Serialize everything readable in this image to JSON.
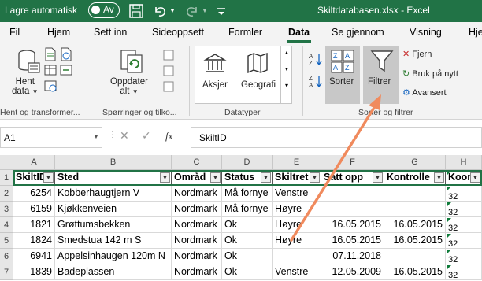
{
  "titlebar": {
    "autosave_label": "Lagre automatisk",
    "toggle_state": "Av",
    "filename": "Skiltdatabasen.xlsx",
    "app": "Excel"
  },
  "tabs": [
    "Fil",
    "Hjem",
    "Sett inn",
    "Sideoppsett",
    "Formler",
    "Data",
    "Se gjennom",
    "Visning",
    "Hje"
  ],
  "active_tab": "Data",
  "ribbon": {
    "get_data": {
      "line1": "Hent",
      "line2": "data"
    },
    "group1_label": "Hent og transformer...",
    "refresh": {
      "line1": "Oppdater",
      "line2": "alt"
    },
    "group2_label": "Spørringer og tilko...",
    "stocks": "Aksjer",
    "geography": "Geografi",
    "group3_label": "Datatyper",
    "sort": "Sorter",
    "filter": "Filtrer",
    "clear": "Fjern",
    "reapply": "Bruk på nytt",
    "advanced": "Avansert",
    "group4_label": "Sorter og filtrer"
  },
  "formula_bar": {
    "name_box": "A1",
    "fx": "fx",
    "formula": "SkiltID"
  },
  "grid": {
    "columns": [
      "A",
      "B",
      "C",
      "D",
      "E",
      "F",
      "G",
      "H"
    ],
    "rows": [
      "1",
      "2",
      "3",
      "4",
      "5",
      "6",
      "7"
    ],
    "header": [
      "SkiltID",
      "Sted",
      "Områd",
      "Status",
      "Skiltret",
      "Satt opp",
      "Kontrolle",
      "Koordi"
    ],
    "data": [
      [
        "6254",
        "Kobberhaugtjern V",
        "Nordmark",
        "Må fornye",
        "Venstre",
        "",
        "",
        ""
      ],
      [
        "6159",
        "Kjøkkenveien",
        "Nordmark",
        "Må fornye",
        "Høyre",
        "",
        "",
        ""
      ],
      [
        "1821",
        "Grøttumsbekken",
        "Nordmark",
        "Ok",
        "Høyre",
        "16.05.2015",
        "16.05.2015",
        ""
      ],
      [
        "1824",
        "Smedstua 142 m S",
        "Nordmark",
        "Ok",
        "Høyre",
        "16.05.2015",
        "16.05.2015",
        ""
      ],
      [
        "6941",
        "Appelsinhaugen 120m N",
        "Nordmark",
        "Ok",
        "",
        "07.11.2018",
        "",
        ""
      ],
      [
        "1839",
        "Badeplassen",
        "Nordmark",
        "Ok",
        "Venstre",
        "12.05.2009",
        "16.05.2015",
        ""
      ]
    ]
  },
  "colors": {
    "excel_green": "#217346",
    "arrow": "#f08a5d"
  }
}
